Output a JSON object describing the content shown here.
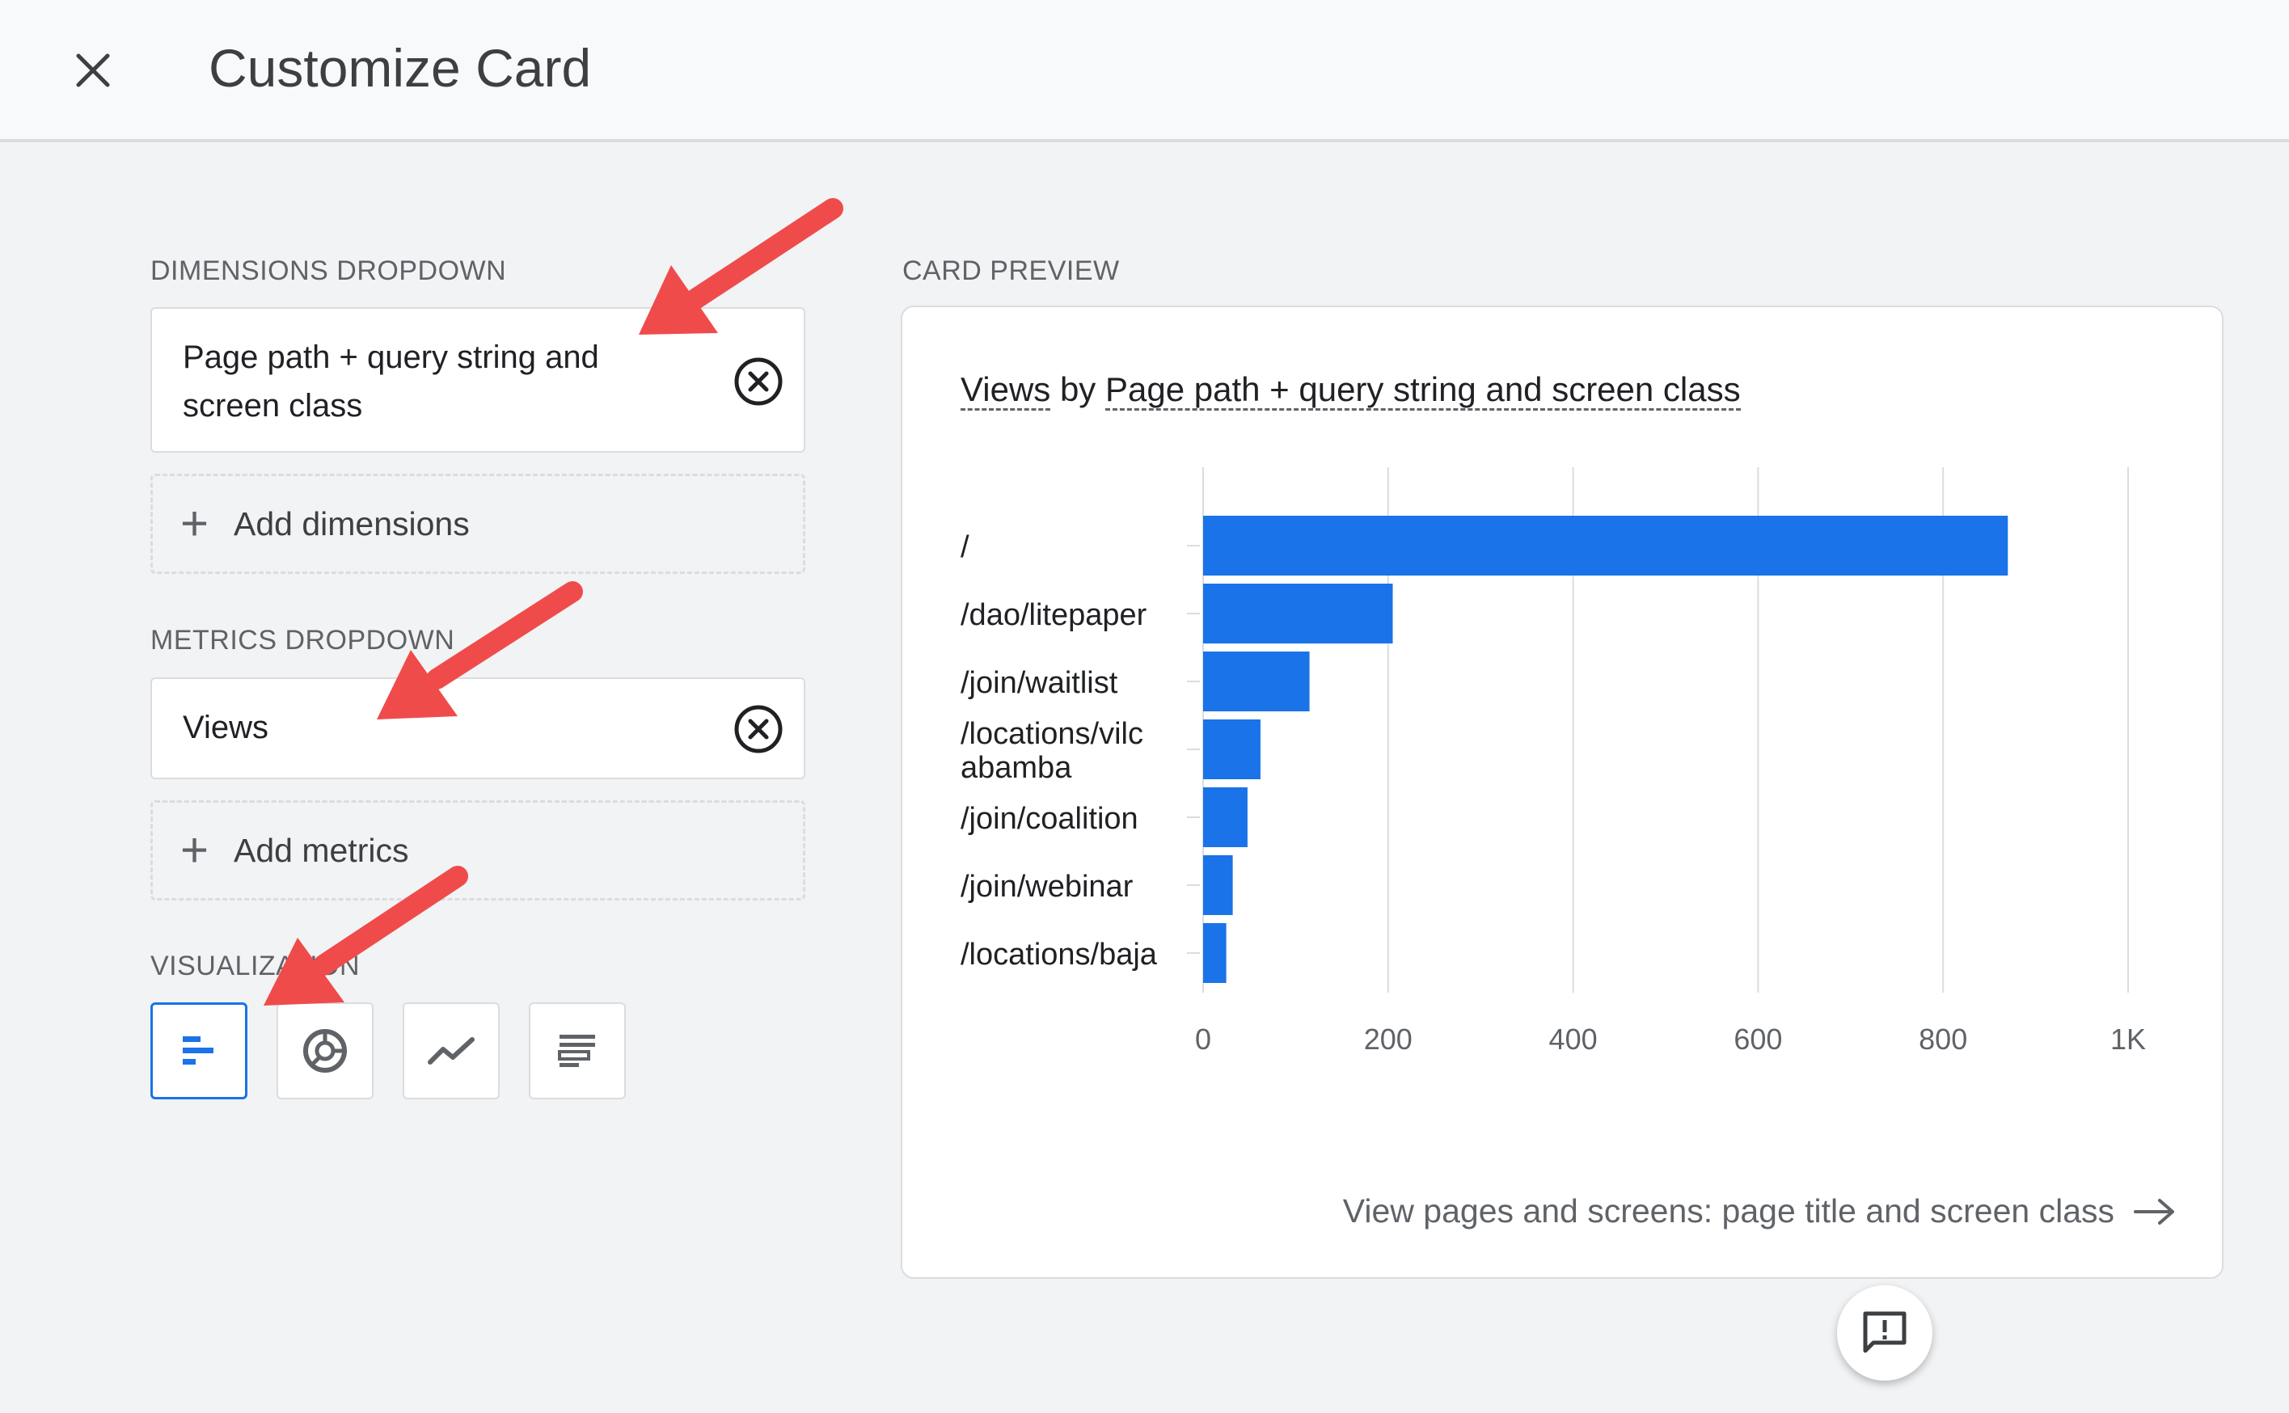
{
  "header": {
    "title": "Customize Card",
    "close_icon": "close-icon"
  },
  "dimensions": {
    "label": "DIMENSIONS DROPDOWN",
    "selected": [
      "Page path + query string and",
      "screen class"
    ],
    "add_label": "Add dimensions"
  },
  "metrics": {
    "label": "METRICS DROPDOWN",
    "selected": "Views",
    "add_label": "Add metrics"
  },
  "visualization": {
    "label": "VISUALIZATION",
    "options": [
      "bar-chart-icon",
      "donut-chart-icon",
      "line-chart-icon",
      "table-icon"
    ],
    "selected_index": 0
  },
  "preview": {
    "label": "CARD PREVIEW",
    "title_metric": "Views",
    "title_by": "by",
    "title_dimension": "Page path + query string and screen class",
    "link_text": "View pages and screens: page title and screen class",
    "link_icon": "arrow-right-icon"
  },
  "chart_data": {
    "type": "bar",
    "orientation": "horizontal",
    "categories": [
      "/",
      "/dao/litepaper",
      "/join/waitlist",
      "/locations/vilcabamba",
      "/join/coalition",
      "/join/webinar",
      "/locations/baja"
    ],
    "category_lines": [
      [
        "/"
      ],
      [
        "/dao/litepaper"
      ],
      [
        "/join/waitlist"
      ],
      [
        "/locations/vilc",
        "abamba"
      ],
      [
        "/join/coalition"
      ],
      [
        "/join/webinar"
      ],
      [
        "/locations/baja"
      ]
    ],
    "values": [
      870,
      205,
      115,
      62,
      48,
      32,
      25
    ],
    "xticks": [
      0,
      200,
      400,
      600,
      800,
      1000
    ],
    "xtick_labels": [
      "0",
      "200",
      "400",
      "600",
      "800",
      "1K"
    ],
    "xlim": [
      0,
      1000
    ],
    "color": "#1a73e8",
    "grid": true
  },
  "feedback_icon": "feedback-icon",
  "annotation_color": "#f04b4b"
}
